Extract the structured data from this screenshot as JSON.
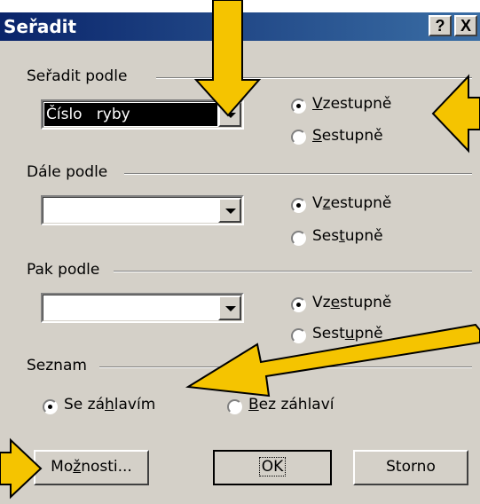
{
  "window": {
    "title": "Seřadit",
    "help_label": "?",
    "close_label": "X"
  },
  "group1": {
    "label": "Seřadit podle",
    "combo_value": "Číslo   ryby",
    "asc": {
      "pre": "",
      "key": "V",
      "post": "zestupně"
    },
    "desc": {
      "pre": "",
      "key": "S",
      "post": "estupně"
    }
  },
  "group2": {
    "label": "Dále podle",
    "asc": {
      "pre": "V",
      "key": "z",
      "post": "estupně"
    },
    "desc": {
      "pre": "Ses",
      "key": "t",
      "post": "upně"
    }
  },
  "group3": {
    "label": "Pak podle",
    "asc": {
      "pre": "Vz",
      "key": "e",
      "post": "stupně"
    },
    "desc": {
      "pre": "Sest",
      "key": "u",
      "post": "pně"
    }
  },
  "list": {
    "label": "Seznam",
    "with_header": {
      "pre": "Se zá",
      "key": "h",
      "post": "lavím"
    },
    "without_header": {
      "pre": "",
      "key": "B",
      "post": "ez záhlaví"
    }
  },
  "buttons": {
    "options": {
      "pre": "Mo",
      "key": "ž",
      "post": "nosti..."
    },
    "ok": "OK",
    "cancel": "Storno"
  },
  "colors": {
    "arrow_fill": "#f5c400",
    "arrow_stroke": "#000000",
    "selection": "#000000"
  }
}
